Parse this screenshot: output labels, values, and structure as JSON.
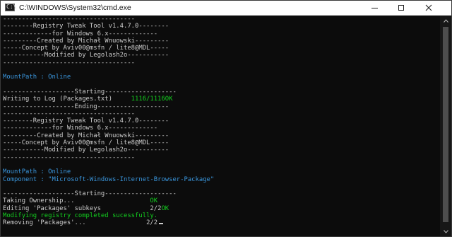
{
  "window": {
    "title": "C:\\WINDOWS\\System32\\cmd.exe",
    "icon": "cmd-icon",
    "icon_glyph": "C:\\"
  },
  "colors": {
    "background": "#0c0c0c",
    "text": "#cccccc",
    "cyan": "#3a96dd",
    "green": "#13d01f"
  },
  "console": {
    "lines": [
      "-----------------------------------",
      "--------Registry Tweak Tool v1.4.7.0--------",
      "-------------for Windows 6.x-------------",
      "---------Created by Michał Wnuowski---------",
      "-----Concept by Aviv00@msfn / lite8@MDL-----",
      "-----------Modified by Legolash2o-----------",
      "-----------------------------------",
      "",
      "MountPath : Online",
      "",
      "-------------------Starting-------------------",
      "Writing to Log (Packages.txt)",
      "-------------------Ending-------------------",
      "-----------------------------------",
      "--------Registry Tweak Tool v1.4.7.0--------",
      "-------------for Windows 6.x-------------",
      "---------Created by Michał Wnuowski---------",
      "-----Concept by Aviv00@msfn / lite8@MDL-----",
      "-----------Modified by Legolash2o-----------",
      "-----------------------------------",
      "",
      "MountPath : Online",
      "Component : \"Microsoft-Windows-Internet-Browser-Package\"",
      "",
      "-------------------Starting-------------------",
      "Taking Ownership...",
      "Editing 'Packages' subkeys",
      "Modifying registry completed sucessfully.",
      "Removing 'Packages'..."
    ],
    "progress_count": "1116/1116",
    "progress_ok": "OK",
    "ownership_ok": "OK",
    "subkeys_count": "2/2",
    "subkeys_ok": "OK",
    "removing_count": "2/2"
  }
}
